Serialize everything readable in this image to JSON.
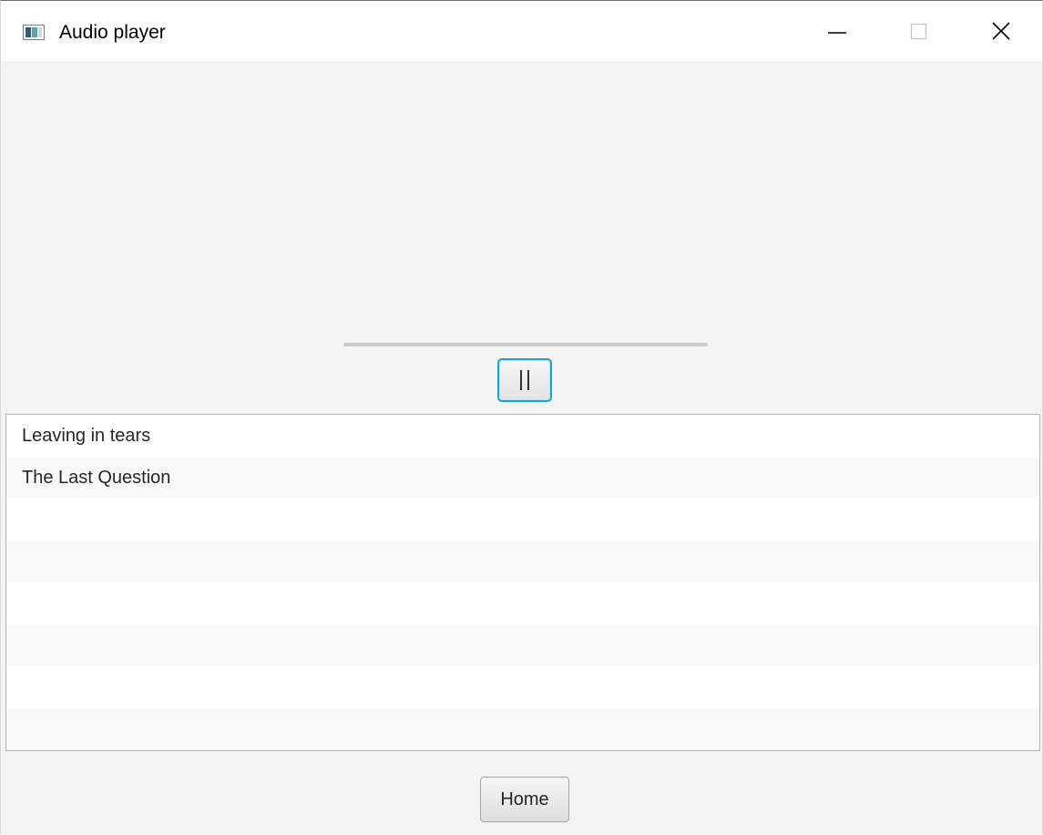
{
  "window": {
    "title": "Audio player",
    "controls": [
      "minimize",
      "maximize",
      "close"
    ]
  },
  "player": {
    "progress_percent": 0,
    "pause_label": "||"
  },
  "playlist": {
    "items": [
      {
        "label": "Leaving in tears"
      },
      {
        "label": "The Last Question"
      },
      {
        "label": ""
      },
      {
        "label": ""
      },
      {
        "label": ""
      },
      {
        "label": ""
      },
      {
        "label": ""
      },
      {
        "label": ""
      }
    ]
  },
  "footer": {
    "home_label": "Home"
  },
  "colors": {
    "focus_border": "#1ca3d8",
    "background": "#f4f4f4",
    "list_background": "#ffffff",
    "list_alt_row": "#f9f9f9"
  }
}
